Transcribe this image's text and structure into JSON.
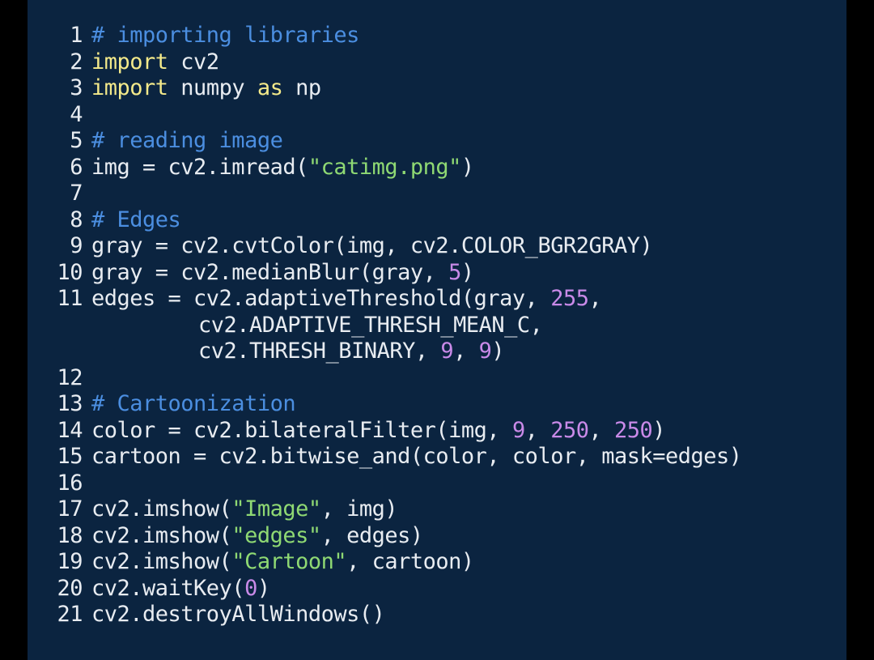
{
  "colors": {
    "background": "#0b2440",
    "text": "#e8ecf1",
    "keyword": "#f3e98a",
    "comment": "#4b8ee0",
    "string": "#8fd973",
    "number": "#c98ae8"
  },
  "code": {
    "l1": {
      "num": "1",
      "comment": "# importing libraries"
    },
    "l2": {
      "num": "2",
      "kw": "import",
      "rest": " cv2"
    },
    "l3": {
      "num": "3",
      "kw1": "import",
      "mid": " numpy ",
      "kw2": "as",
      "rest": " np"
    },
    "l4": {
      "num": "4"
    },
    "l5": {
      "num": "5",
      "comment": "# reading image"
    },
    "l6": {
      "num": "6",
      "pre": "img = cv2.imread(",
      "str": "\"catimg.png\"",
      "post": ")"
    },
    "l7": {
      "num": "7"
    },
    "l8": {
      "num": "8",
      "comment": "# Edges"
    },
    "l9": {
      "num": "9",
      "text": "gray = cv2.cvtColor(img, cv2.COLOR_BGR2GRAY)"
    },
    "l10": {
      "num": "10",
      "pre": "gray = cv2.medianBlur(gray, ",
      "n1": "5",
      "post": ")"
    },
    "l11": {
      "num": "11",
      "pre": "edges = cv2.adaptiveThreshold(gray, ",
      "n1": "255",
      "post": ","
    },
    "l11b": {
      "text": "cv2.ADAPTIVE_THRESH_MEAN_C,"
    },
    "l11c": {
      "pre": "cv2.THRESH_BINARY, ",
      "n1": "9",
      "mid": ", ",
      "n2": "9",
      "post": ")"
    },
    "l12": {
      "num": "12"
    },
    "l13": {
      "num": "13",
      "comment": "# Cartoonization"
    },
    "l14": {
      "num": "14",
      "pre": "color = cv2.bilateralFilter(img, ",
      "n1": "9",
      "s1": ", ",
      "n2": "250",
      "s2": ", ",
      "n3": "250",
      "post": ")"
    },
    "l15": {
      "num": "15",
      "text": "cartoon = cv2.bitwise_and(color, color, mask=edges)"
    },
    "l16": {
      "num": "16"
    },
    "l17": {
      "num": "17",
      "pre": "cv2.imshow(",
      "str": "\"Image\"",
      "post": ", img)"
    },
    "l18": {
      "num": "18",
      "pre": "cv2.imshow(",
      "str": "\"edges\"",
      "post": ", edges)"
    },
    "l19": {
      "num": "19",
      "pre": "cv2.imshow(",
      "str": "\"Cartoon\"",
      "post": ", cartoon)"
    },
    "l20": {
      "num": "20",
      "pre": "cv2.waitKey(",
      "n1": "0",
      "post": ")"
    },
    "l21": {
      "num": "21",
      "text": "cv2.destroyAllWindows()"
    }
  }
}
